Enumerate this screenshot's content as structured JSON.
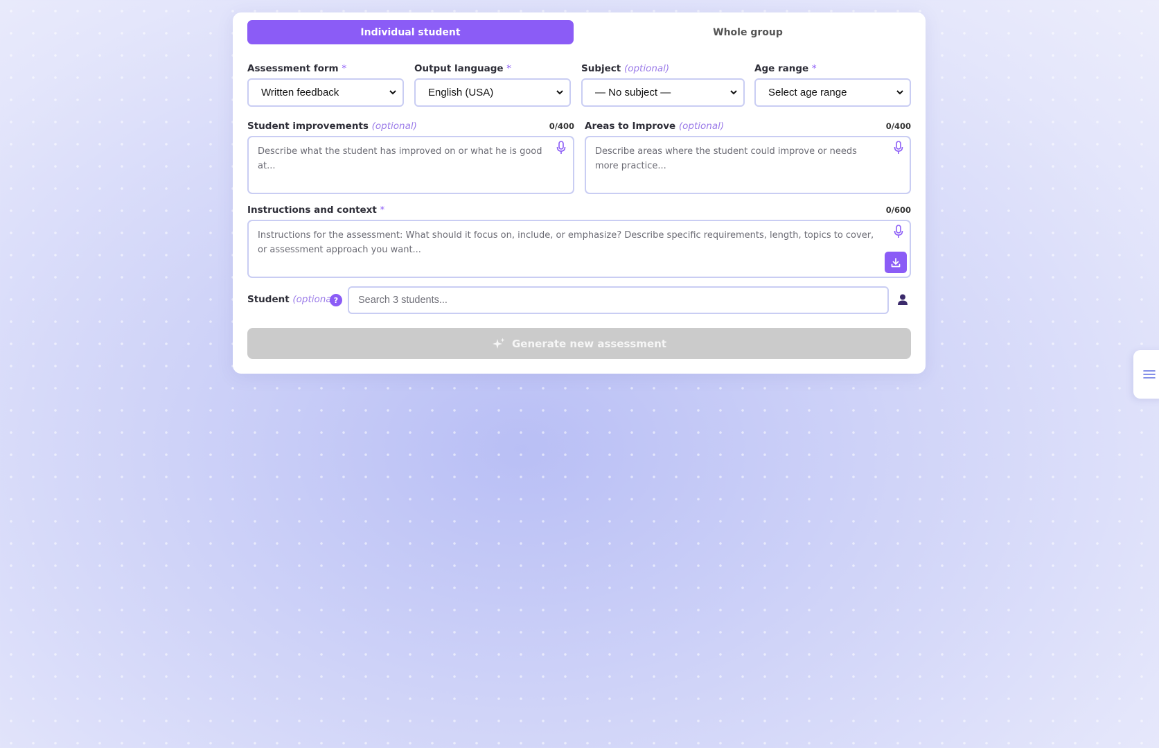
{
  "tabs": {
    "individual": "Individual student",
    "group": "Whole group"
  },
  "fields": {
    "assessment_form": {
      "label": "Assessment form",
      "required_mark": "*",
      "value": "Written feedback"
    },
    "output_language": {
      "label": "Output language",
      "required_mark": "*",
      "value": "English (USA)"
    },
    "subject": {
      "label": "Subject",
      "optional_text": "(optional)",
      "value": "— No subject —"
    },
    "age_range": {
      "label": "Age range",
      "required_mark": "*",
      "value": "Select age range"
    }
  },
  "improvements": {
    "label": "Student improvements",
    "optional_text": "(optional)",
    "counter": "0/400",
    "placeholder": "Describe what the student has improved on or what he is good at..."
  },
  "areas": {
    "label": "Areas to Improve",
    "optional_text": "(optional)",
    "counter": "0/400",
    "placeholder": "Describe areas where the student could improve or needs more practice..."
  },
  "instructions": {
    "label": "Instructions and context",
    "required_mark": "*",
    "counter": "0/600",
    "placeholder": "Instructions for the assessment: What should it focus on, include, or emphasize? Describe specific requirements, length, topics to cover, or assessment approach you want..."
  },
  "student": {
    "label": "Student",
    "optional_text": "(optional)",
    "help_glyph": "?",
    "search_placeholder": "Search 3 students..."
  },
  "generate_button": "Generate new assessment",
  "colors": {
    "accent": "#8b5cf6",
    "disabled_button": "#cbcbcb",
    "field_border": "#c9cdf3"
  },
  "icons": [
    "microphone-icon",
    "download-icon",
    "person-icon",
    "sparkles-icon",
    "menu-icon",
    "chevron-down-icon",
    "help-icon"
  ]
}
